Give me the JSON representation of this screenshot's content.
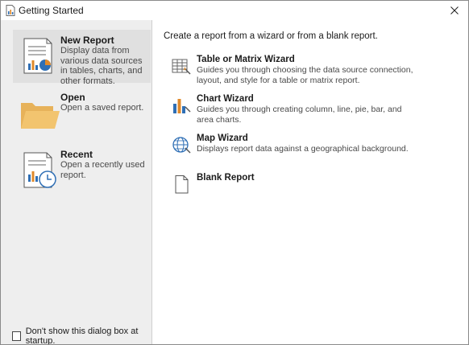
{
  "window": {
    "title": "Getting Started",
    "close_glyph": "✕"
  },
  "sidebar": {
    "items": [
      {
        "title": "New Report",
        "description": "Display data from various data sources in tables, charts, and other formats.",
        "icon": "new-report-icon",
        "selected": true
      },
      {
        "title": "Open",
        "description": "Open a saved report.",
        "icon": "folder-icon",
        "selected": false
      },
      {
        "title": "Recent",
        "description": "Open a recently used report.",
        "icon": "recent-report-icon",
        "selected": false
      }
    ],
    "startup_checkbox": {
      "label": "Don't show this dialog box at startup.",
      "checked": false
    }
  },
  "main": {
    "intro": "Create a report from a wizard or from a blank report.",
    "options": [
      {
        "title": "Table or Matrix Wizard",
        "description": "Guides you through choosing the data source connection, layout, and style for a table or matrix report.",
        "icon": "table-wizard-icon"
      },
      {
        "title": "Chart Wizard",
        "description": "Guides you through creating column, line, pie, bar, and area charts.",
        "icon": "chart-wizard-icon"
      },
      {
        "title": "Map Wizard",
        "description": "Displays report data against a geographical background.",
        "icon": "map-wizard-icon"
      },
      {
        "title": "Blank Report",
        "description": "",
        "icon": "blank-report-icon"
      }
    ]
  },
  "colors": {
    "sidebar_bg": "#eeeeee",
    "selected_bg": "#e0e0e0",
    "folder": "#f2c46f",
    "chart_blue": "#2f6fb5",
    "chart_orange": "#e08a2b"
  }
}
